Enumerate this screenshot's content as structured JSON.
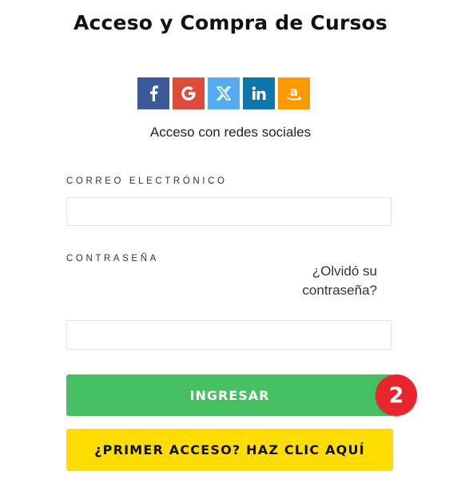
{
  "header": {
    "title": "Acceso y Compra de Cursos"
  },
  "social": {
    "buttons": [
      {
        "name": "facebook",
        "icon": "facebook-icon",
        "color": "#3b5998"
      },
      {
        "name": "google",
        "icon": "google-icon",
        "color": "#dd4b39"
      },
      {
        "name": "x",
        "icon": "x-icon",
        "color": "#55acee"
      },
      {
        "name": "linkedin",
        "icon": "linkedin-icon",
        "color": "#0e76a8"
      },
      {
        "name": "amazon",
        "icon": "amazon-icon",
        "color": "#ff9900"
      }
    ],
    "caption": "Acceso con redes sociales"
  },
  "form": {
    "email_label": "CORREO ELECTRÓNICO",
    "email_value": "",
    "email_placeholder": "",
    "password_label": "CONTRASEÑA",
    "password_value": "",
    "password_placeholder": "",
    "forgot_link": "¿Olvidó su contraseña?",
    "login_button": "INGRESAR",
    "first_access_button": "¿PRIMER ACCESO? HAZ CLIC AQUÍ"
  },
  "annotation": {
    "badge_number": "2"
  },
  "colors": {
    "login_button_bg": "#46be62",
    "first_access_bg": "#ffdd00",
    "badge_bg": "#e8242c"
  }
}
